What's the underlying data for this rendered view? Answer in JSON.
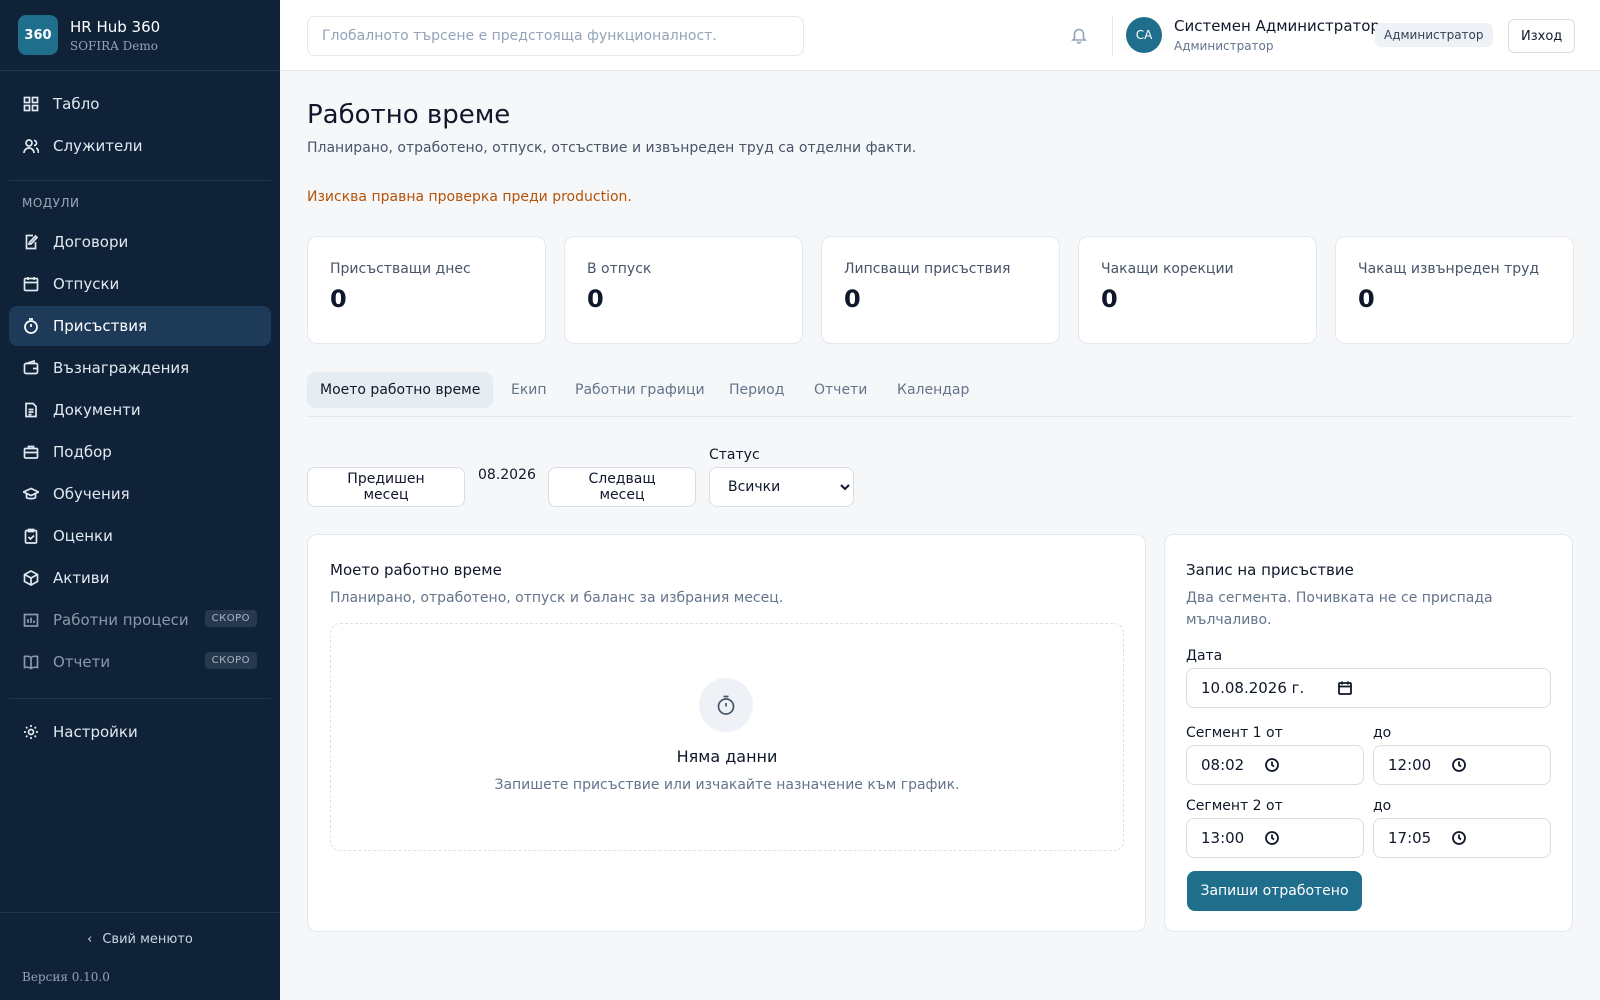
{
  "brand": {
    "logo": "360",
    "title": "HR Hub 360",
    "subtitle": "SOFIRA Demo"
  },
  "sidebar": {
    "top_items": [
      {
        "label": "Табло",
        "icon": "dashboard-icon"
      },
      {
        "label": "Служители",
        "icon": "users-icon"
      }
    ],
    "section_label": "МОДУЛИ",
    "module_items": [
      {
        "label": "Договори",
        "icon": "contract-icon"
      },
      {
        "label": "Отпуски",
        "icon": "calendar-icon"
      },
      {
        "label": "Присъствия",
        "icon": "stopwatch-icon",
        "active": true
      },
      {
        "label": "Възнаграждения",
        "icon": "wallet-icon"
      },
      {
        "label": "Документи",
        "icon": "document-icon"
      },
      {
        "label": "Подбор",
        "icon": "briefcase-icon"
      },
      {
        "label": "Обучения",
        "icon": "graduation-cap-icon"
      },
      {
        "label": "Оценки",
        "icon": "clipboard-check-icon"
      },
      {
        "label": "Активи",
        "icon": "box-icon"
      },
      {
        "label": "Работни процеси",
        "icon": "workflow-icon",
        "badge": "СКОРО"
      },
      {
        "label": "Отчети",
        "icon": "book-icon",
        "badge": "СКОРО"
      }
    ],
    "settings_item": {
      "label": "Настройки",
      "icon": "gear-icon"
    },
    "collapse_label": "Свий менюто",
    "version": "Версия 0.10.0"
  },
  "topbar": {
    "search_placeholder": "Глобалното търсене е предстояща функционалност.",
    "user_initials": "СА",
    "user_name": "Системен Администратор",
    "user_role": "Администратор",
    "role_badge": "Администратор",
    "logout_label": "Изход"
  },
  "page": {
    "title": "Работно време",
    "subtitle": "Планирано, отработено, отпуск, отсъствие и извънреден труд са отделни факти.",
    "legal_note": "Изисква правна проверка преди production."
  },
  "stats": [
    {
      "label": "Присъстващи днес",
      "value": "0"
    },
    {
      "label": "В отпуск",
      "value": "0"
    },
    {
      "label": "Липсващи присъствия",
      "value": "0"
    },
    {
      "label": "Чакащи корекции",
      "value": "0"
    },
    {
      "label": "Чакащ извънреден труд",
      "value": "0"
    }
  ],
  "tabs": [
    {
      "label": "Моето работно време",
      "active": true
    },
    {
      "label": "Екип"
    },
    {
      "label": "Работни графици"
    },
    {
      "label": "Период"
    },
    {
      "label": "Отчети"
    },
    {
      "label": "Календар"
    }
  ],
  "month_nav": {
    "prev_label": "Предишен месец",
    "current": "08.2026",
    "next_label": "Следващ месец"
  },
  "status_filter": {
    "label": "Статус",
    "selected": "Всички"
  },
  "my_time_panel": {
    "title": "Моето работно време",
    "subtitle": "Планирано, отработено, отпуск и баланс за избрания месец.",
    "empty_title": "Няма данни",
    "empty_text": "Запишете присъствие или изчакайте назначение към график."
  },
  "attendance_form": {
    "title": "Запис на присъствие",
    "subtitle": "Два сегмента. Почивката не се приспада мълчаливо.",
    "date_label": "Дата",
    "date_value": "10.08.2026 г.",
    "seg1_from_label": "Сегмент 1 от",
    "seg1_to_label": "до",
    "seg1_from": "08:02",
    "seg1_to": "12:00",
    "seg2_from_label": "Сегмент 2 от",
    "seg2_to_label": "до",
    "seg2_from": "13:00",
    "seg2_to": "17:05",
    "submit_label": "Запиши отработено"
  },
  "colors": {
    "sidebar_bg": "#0f2237",
    "accent": "#1f6e8c",
    "warning_text": "#b45309"
  }
}
